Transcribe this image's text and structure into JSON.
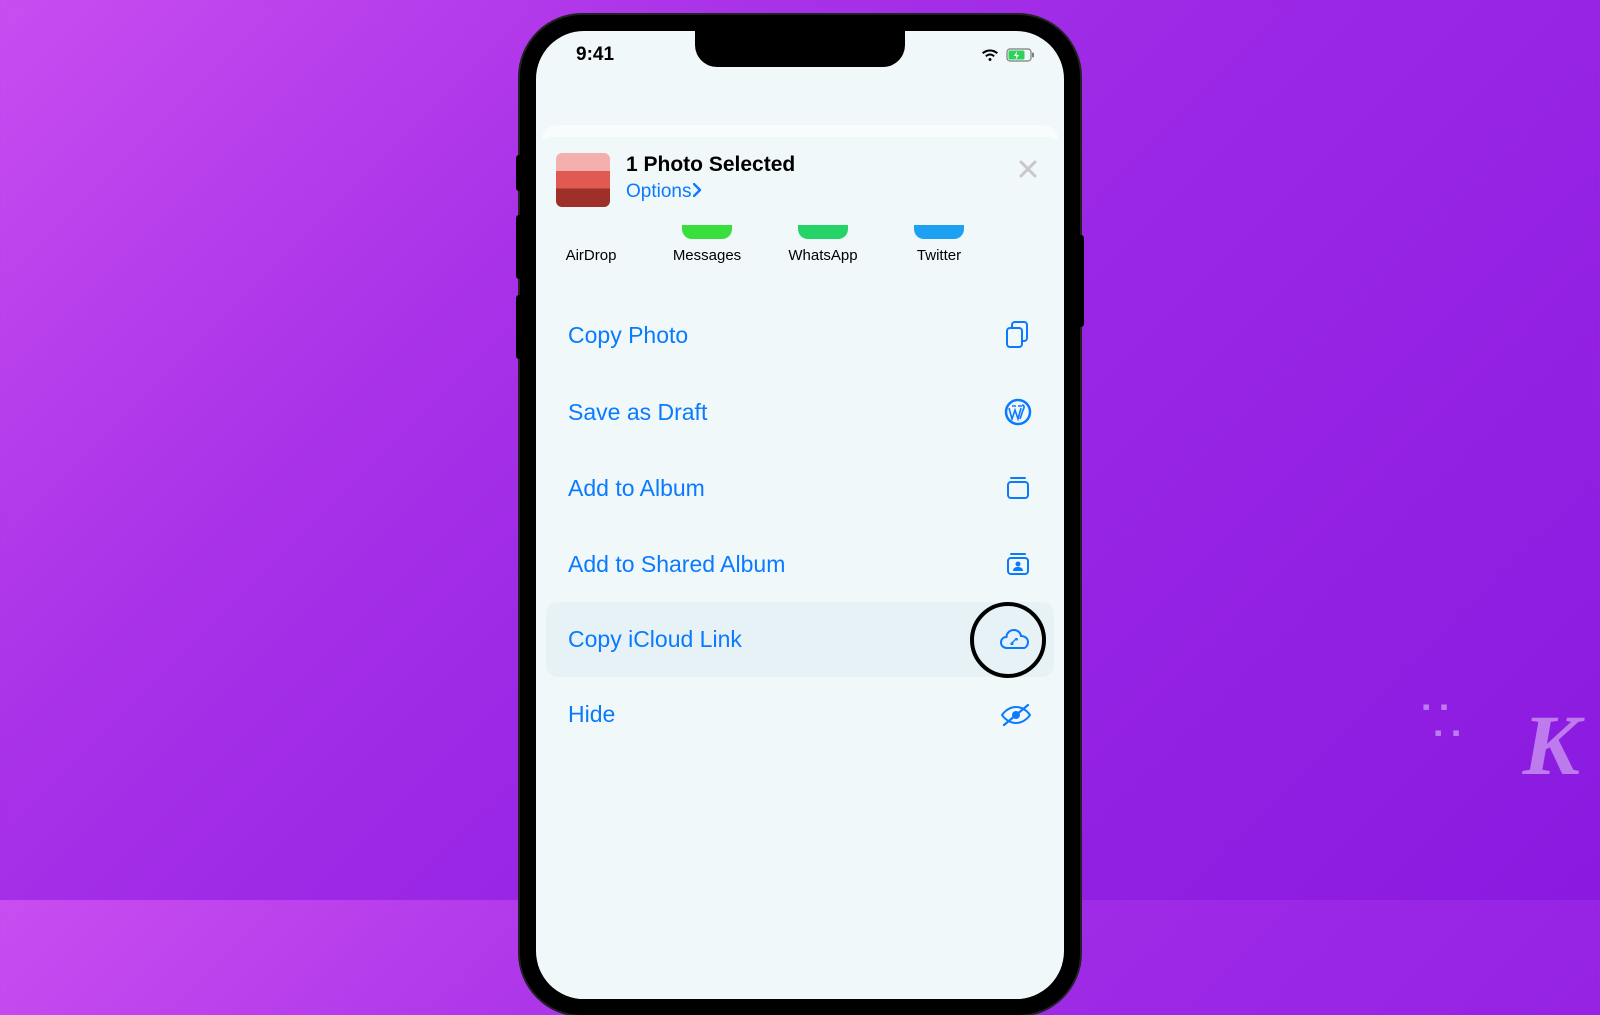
{
  "status_bar": {
    "time": "9:41"
  },
  "share_sheet": {
    "title": "1 Photo Selected",
    "options_label": "Options",
    "apps": [
      {
        "label": "AirDrop",
        "color_class": "airdrop"
      },
      {
        "label": "Messages",
        "color_class": "messages"
      },
      {
        "label": "WhatsApp",
        "color_class": "whatsapp"
      },
      {
        "label": "Twitter",
        "color_class": "twitter"
      }
    ],
    "actions": [
      {
        "label": "Copy Photo",
        "icon": "copy"
      },
      {
        "label": "Save as Draft",
        "icon": "wordpress"
      },
      {
        "label": "Add to Album",
        "icon": "album"
      },
      {
        "label": "Add to Shared Album",
        "icon": "shared-album"
      },
      {
        "label": "Copy iCloud Link",
        "icon": "cloud-link",
        "highlighted": true
      },
      {
        "label": "Hide",
        "icon": "eye-slash"
      }
    ]
  },
  "branding": {
    "logo": "K"
  }
}
